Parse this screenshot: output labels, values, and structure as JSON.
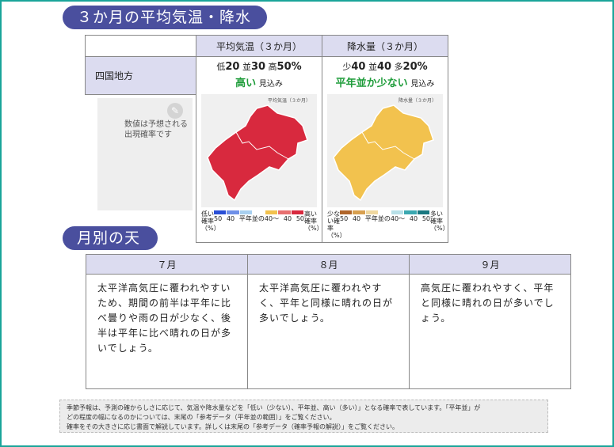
{
  "section1_title": "３か月の平均気温・降水量",
  "section2_title": "月別の天候",
  "table": {
    "temp_header": "平均気温（３か月）",
    "precip_header": "降水量（３か月）",
    "region": "四国地方",
    "temp": {
      "low_label": "低",
      "low": "20",
      "normal_label": "並",
      "normal": "30",
      "high_label": "高",
      "high": "50%",
      "verdict": "高い",
      "outlook": "見込み",
      "map_title": "平均気温（３か月）",
      "legend_left": "低い確率（%）",
      "legend_right": "高い確率（%）",
      "legend_nums": [
        "50",
        "40",
        "40",
        "50"
      ],
      "legend_note": "平年並の40～",
      "map_color": "#d8293e"
    },
    "precip": {
      "low_label": "少",
      "low": "40",
      "normal_label": "並",
      "normal": "40",
      "high_label": "多",
      "high": "20%",
      "verdict": "平年並か少ない",
      "outlook": "見込み",
      "map_title": "降水量（３か月）",
      "legend_left": "少ない確率（%）",
      "legend_right": "多い確率（%）",
      "legend_nums": [
        "50",
        "40",
        "40",
        "50"
      ],
      "legend_note": "平年並の40～",
      "map_color": "#f2c24e"
    },
    "note_icon": "pencil-icon",
    "note_text": [
      "数値は予想される",
      "出現確率です"
    ],
    "temp_legend_colors": [
      "#2a4fd6",
      "#6f90e8",
      "#a8d0f0",
      "#ffffff",
      "#f2c24e",
      "#e87070",
      "#d8293e"
    ],
    "precip_legend_colors": [
      "#b0652a",
      "#d8a050",
      "#f0d8a0",
      "#ffffff",
      "#b8e0e8",
      "#3aa8b0",
      "#1a7880"
    ]
  },
  "monthly": {
    "headers": [
      "７月",
      "８月",
      "９月"
    ],
    "texts": [
      "太平洋高気圧に覆われやすいため、期間の前半は平年に比べ曇りや雨の日が少なく、後半は平年に比べ晴れの日が多いでしょう。",
      "太平洋高気圧に覆われやすく、平年と同様に晴れの日が多いでしょう。",
      "高気圧に覆われやすく、平年と同様に晴れの日が多いでしょう。"
    ]
  },
  "footnote": [
    "季節予報は、予測の確からしさに応じて、気温や降水量などを「低い（少ない）、平年並、高い（多い）」となる確率で表しています。「平年並」が",
    "どの程度の幅になるのかについては、末尾の「参考データ（平年並の範囲）」をご覧ください。",
    "確率をその大きさに応じ書面で解説しています。詳しくは末尾の「参考データ（確率予報の解説）」をご覧ください。"
  ],
  "colors": {
    "accent": "#4a4f9e",
    "header_bg": "#dcdcf0",
    "frame": "#1aa59a",
    "verdict": "#1e9c3a"
  }
}
